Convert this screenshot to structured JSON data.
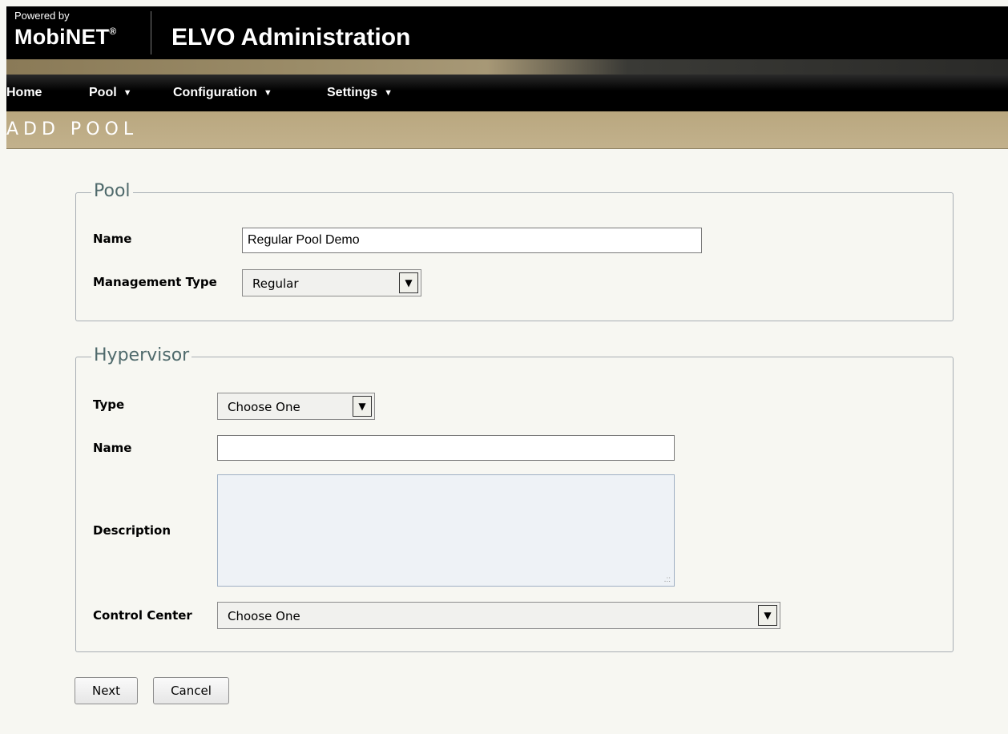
{
  "header": {
    "powered_by": "Powered by",
    "brand": "MobiNET",
    "brand_mark": "®",
    "app_title": "ELVO Administration"
  },
  "nav": {
    "home": "Home",
    "pool": "Pool",
    "configuration": "Configuration",
    "settings": "Settings",
    "caret": "▼"
  },
  "page_title": "ADD POOL",
  "pool_section": {
    "legend": "Pool",
    "name_label": "Name",
    "name_value": "Regular Pool Demo",
    "management_type_label": "Management Type",
    "management_type_value": "Regular"
  },
  "hypervisor_section": {
    "legend": "Hypervisor",
    "type_label": "Type",
    "type_value": "Choose One",
    "name_label": "Name",
    "name_value": "",
    "description_label": "Description",
    "control_center_label": "Control Center",
    "control_center_value": "Choose One"
  },
  "actions": {
    "next": "Next",
    "cancel": "Cancel"
  },
  "colors": {
    "header_bg": "#000000",
    "title_band": "#bfae88",
    "legend_text": "#4f6a6c",
    "page_bg": "#f7f7f2"
  }
}
